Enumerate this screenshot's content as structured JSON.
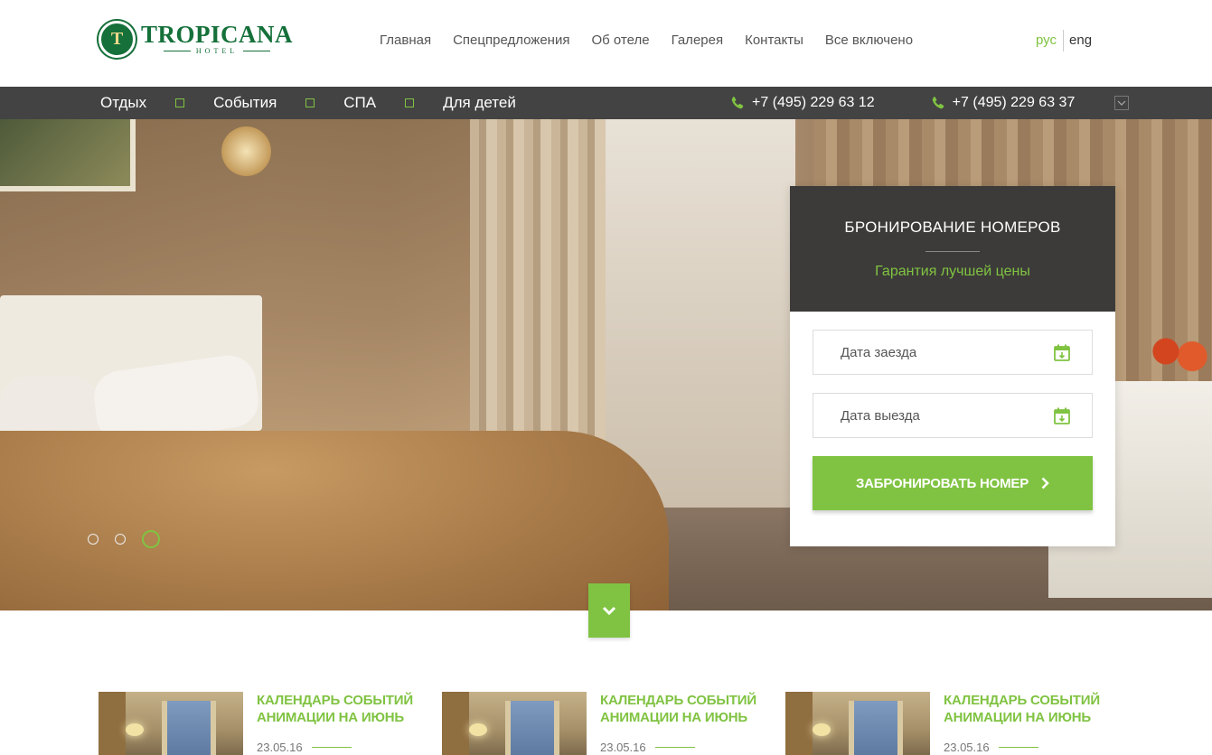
{
  "logo": {
    "badge": "T",
    "name": "TROPICANA",
    "sub": "HOTEL"
  },
  "main_nav": [
    "Главная",
    "Спецпредложения",
    "Об отеле",
    "Галерея",
    "Контакты",
    "Все включено"
  ],
  "lang": {
    "ru": "рус",
    "en": "eng"
  },
  "sub_nav": [
    "Отдых",
    "События",
    "СПА",
    "Для детей"
  ],
  "phones": [
    "+7 (495) 229 63 12",
    "+7 (495) 229 63 37"
  ],
  "booking": {
    "title": "БРОНИРОВАНИЕ НОМЕРОВ",
    "subtitle": "Гарантия лучшей цены",
    "checkin_placeholder": "Дата заезда",
    "checkout_placeholder": "Дата выезда",
    "button": "ЗАБРОНИРОВАТЬ НОМЕР"
  },
  "slider": {
    "count": 3,
    "active": 3
  },
  "news": [
    {
      "title": "КАЛЕНДАРЬ СОБЫТИЙ АНИМАЦИИ НА ИЮНЬ",
      "date": "23.05.16"
    },
    {
      "title": "КАЛЕНДАРЬ СОБЫТИЙ АНИМАЦИИ НА ИЮНЬ",
      "date": "23.05.16"
    },
    {
      "title": "КАЛЕНДАРЬ СОБЫТИЙ АНИМАЦИИ НА ИЮНЬ",
      "date": "23.05.16"
    }
  ],
  "colors": {
    "accent": "#80c342",
    "brand": "#15703a",
    "dark_bar": "#3c3b39"
  }
}
